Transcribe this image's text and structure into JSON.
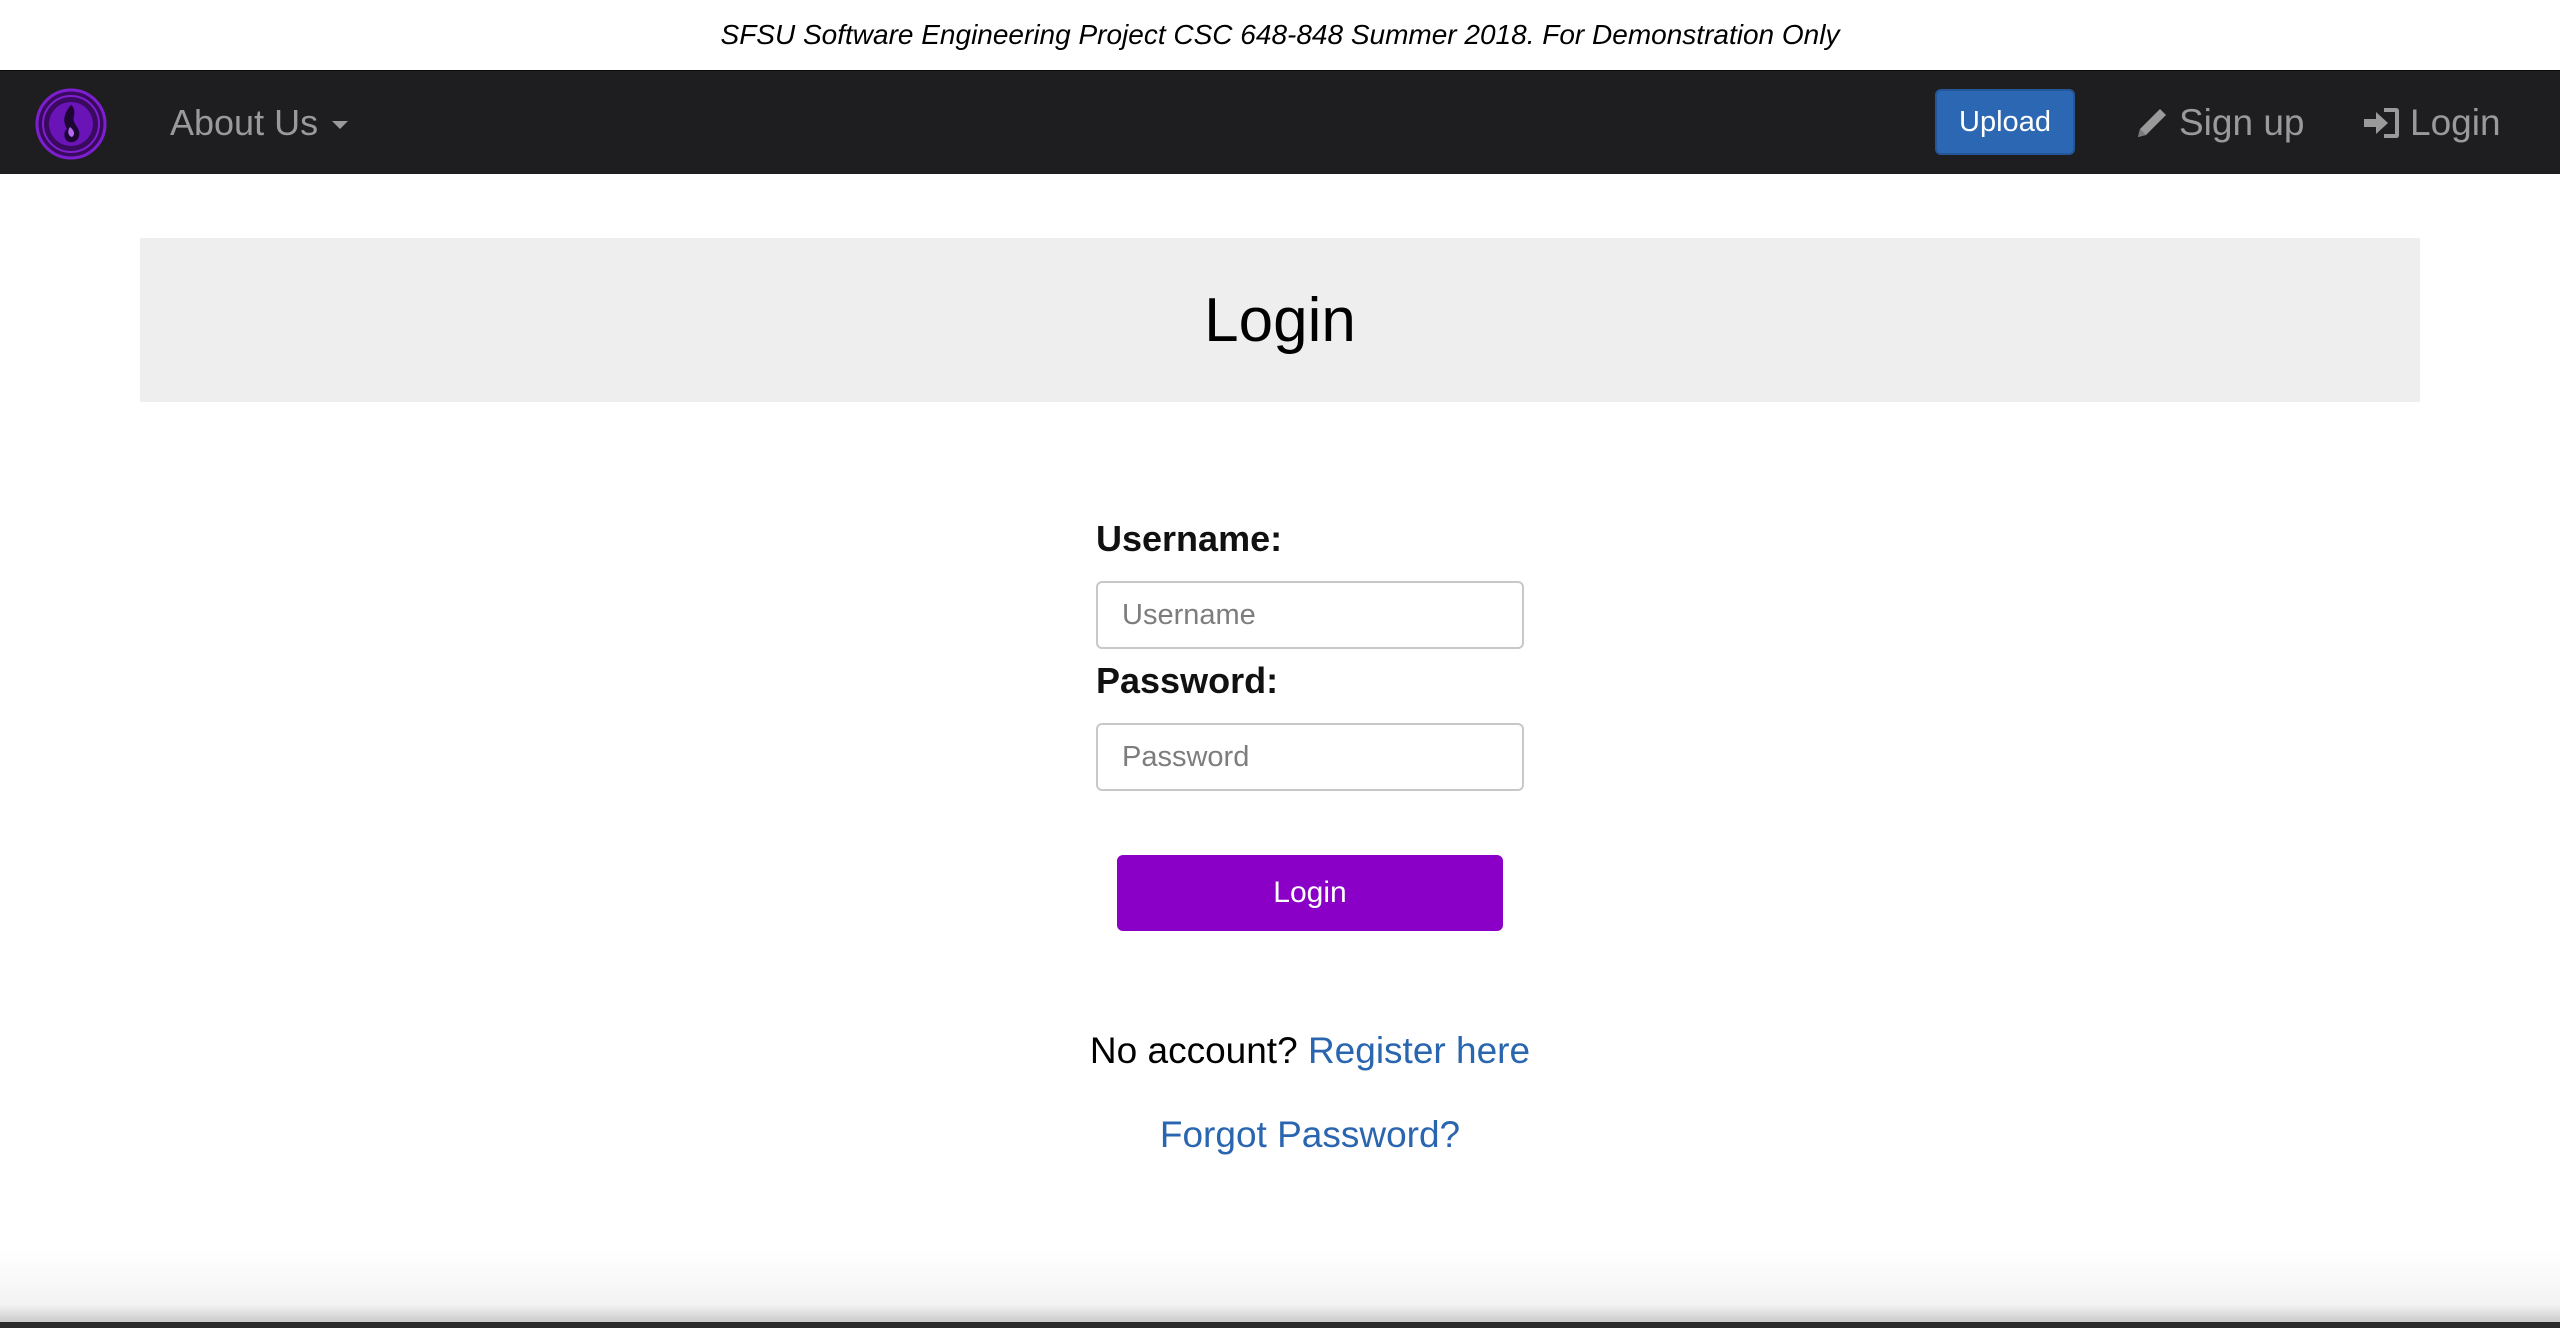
{
  "banner": {
    "text": "SFSU Software Engineering Project CSC 648-848 Summer 2018. For Demonstration Only"
  },
  "navbar": {
    "about_label": "About Us",
    "upload_label": "Upload",
    "signup_label": "Sign up",
    "login_label": "Login",
    "logo_icon": "flame-logo-icon",
    "colors": {
      "background": "#1e1e20",
      "text": "#9a9a9a",
      "upload": "#2b67b2",
      "logo": "#7d1fd1"
    }
  },
  "page": {
    "title": "Login"
  },
  "form": {
    "username_label": "Username:",
    "username_placeholder": "Username",
    "username_value": "",
    "password_label": "Password:",
    "password_placeholder": "Password",
    "password_value": "",
    "submit_label": "Login",
    "submit_color": "#8a00c7"
  },
  "links": {
    "no_account_text": "No account?",
    "register_label": "Register here",
    "forgot_label": "Forgot Password?",
    "link_color": "#2a65b0"
  }
}
